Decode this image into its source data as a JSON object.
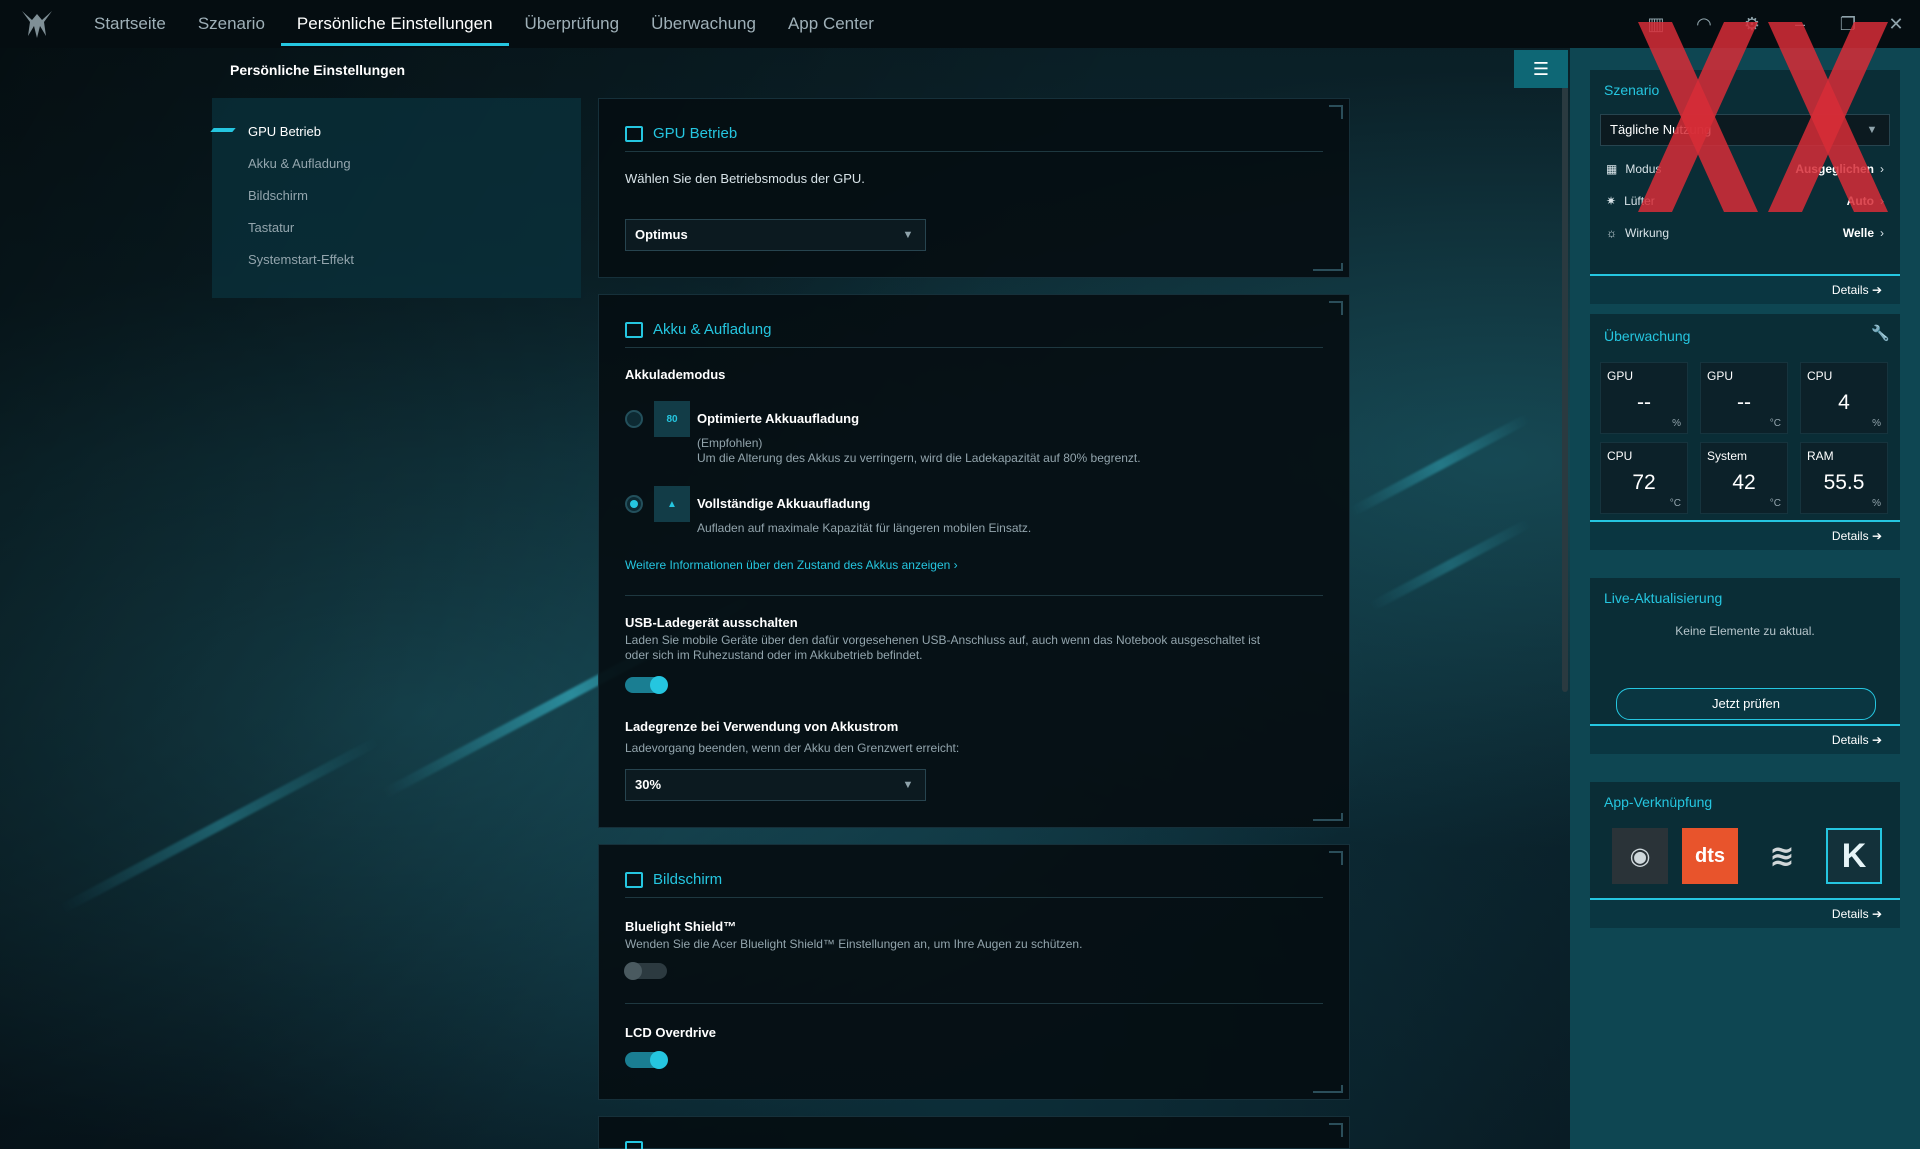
{
  "nav": {
    "tabs": [
      {
        "label": "Startseite"
      },
      {
        "label": "Szenario"
      },
      {
        "label": "Persönliche Einstellungen"
      },
      {
        "label": "Überprüfung"
      },
      {
        "label": "Überwachung"
      },
      {
        "label": "App Center"
      }
    ]
  },
  "page": {
    "title": "Persönliche Einstellungen"
  },
  "sidenav": {
    "items": [
      {
        "label": "GPU Betrieb"
      },
      {
        "label": "Akku & Aufladung"
      },
      {
        "label": "Bildschirm"
      },
      {
        "label": "Tastatur"
      },
      {
        "label": "Systemstart-Effekt"
      }
    ]
  },
  "gpu": {
    "title": "GPU Betrieb",
    "description": "Wählen Sie den Betriebsmodus der GPU.",
    "mode": "Optimus"
  },
  "akku": {
    "title": "Akku & Aufladung",
    "mode_label": "Akkulademodus",
    "optimized_title": "Optimierte Akkuaufladung",
    "optimized_badge": "80",
    "optimized_rec": "(Empfohlen)",
    "optimized_desc": "Um die Alterung des Akkus zu verringern, wird die Ladekapazität auf 80% begrenzt.",
    "full_title": "Vollständige Akkuaufladung",
    "full_desc": "Aufladen auf maximale Kapazität für längeren mobilen Einsatz.",
    "more_link": "Weitere Informationen über den Zustand des Akkus anzeigen ›",
    "usb_title": "USB-Ladegerät ausschalten",
    "usb_desc": "Laden Sie mobile Geräte über den dafür vorgesehenen USB-Anschluss auf, auch wenn das Notebook ausgeschaltet ist oder sich im Ruhezustand oder im Akkubetrieb befindet.",
    "limit_title": "Ladegrenze bei Verwendung von Akkustrom",
    "limit_desc": "Ladevorgang beenden, wenn der Akku den Grenzwert erreicht:",
    "limit_value": "30%"
  },
  "display": {
    "title": "Bildschirm",
    "bluelight_title": "Bluelight Shield™",
    "bluelight_desc": "Wenden Sie die Acer Bluelight Shield™ Einstellungen an, um Ihre Augen zu schützen.",
    "lcd_title": "LCD Overdrive"
  },
  "right": {
    "szenario": {
      "title": "Szenario",
      "selected": "Tägliche Nutzung",
      "rows": [
        {
          "label": "Modus",
          "value": "Ausgeglichen"
        },
        {
          "label": "Lüfter",
          "value": "Auto"
        },
        {
          "label": "Wirkung",
          "value": "Welle"
        }
      ],
      "details": "Details"
    },
    "monitor": {
      "title": "Überwachung",
      "tiles": [
        {
          "title": "GPU",
          "value": "--",
          "unit": "%"
        },
        {
          "title": "GPU",
          "value": "--",
          "unit": "°C"
        },
        {
          "title": "CPU",
          "value": "4",
          "unit": "%"
        },
        {
          "title": "CPU",
          "value": "72",
          "unit": "°C"
        },
        {
          "title": "System",
          "value": "42",
          "unit": "°C"
        },
        {
          "title": "RAM",
          "value": "55.5",
          "unit": "%"
        }
      ],
      "details": "Details"
    },
    "live": {
      "title": "Live-Aktualisierung",
      "message": "Keine Elemente zu aktual.",
      "button": "Jetzt prüfen",
      "details": "Details"
    },
    "apps": {
      "title": "App-Verknüpfung",
      "dts_label": "dts",
      "k_label": "K",
      "details": "Details"
    }
  },
  "colors": {
    "accent": "#25c6e0",
    "panel": "#0e4652",
    "card": "#050e12"
  }
}
